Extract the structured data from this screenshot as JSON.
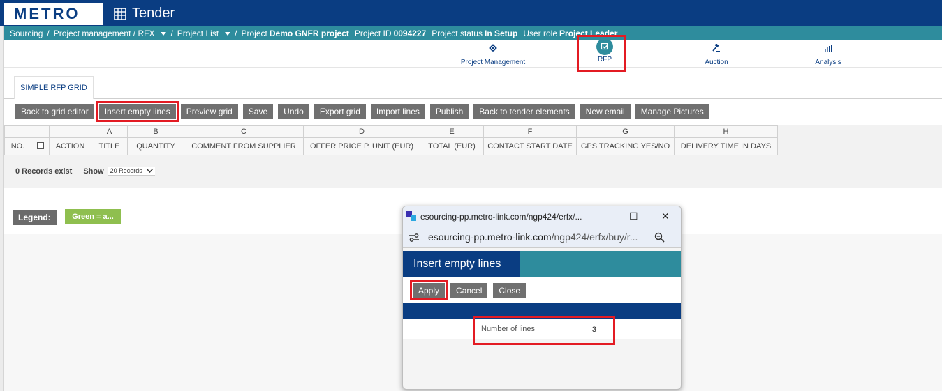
{
  "header": {
    "logo": "METRO",
    "app_title": "Tender"
  },
  "breadcrumb": {
    "sourcing": "Sourcing",
    "sep": "/",
    "project_mgmt": "Project management / RFX",
    "project_list": "Project List",
    "project_label": "Project",
    "project_name": "Demo GNFR project",
    "project_id_label": "Project ID",
    "project_id": "0094227",
    "status_label": "Project status",
    "status": "In Setup",
    "role_label": "User role",
    "role": "Project Leader"
  },
  "stepper": {
    "steps": [
      {
        "label": "Project Management",
        "icon": "gear-icon"
      },
      {
        "label": "RFP",
        "icon": "rfp-icon"
      },
      {
        "label": "Auction",
        "icon": "gavel-icon"
      },
      {
        "label": "Analysis",
        "icon": "bar-chart-icon"
      }
    ]
  },
  "tabs": {
    "simple_rfp_grid": "SIMPLE RFP GRID"
  },
  "toolbar": {
    "buttons": [
      "Back to grid editor",
      "Insert empty lines",
      "Preview grid",
      "Save",
      "Undo",
      "Export grid",
      "Import lines",
      "Publish",
      "Back to tender elements",
      "New email",
      "Manage Pictures"
    ]
  },
  "grid": {
    "letters": [
      "",
      "",
      "",
      "A",
      "B",
      "C",
      "D",
      "E",
      "F",
      "G",
      "H"
    ],
    "columns": [
      "NO.",
      "",
      "ACTION",
      "TITLE",
      "QUANTITY",
      "COMMENT FROM SUPPLIER",
      "OFFER PRICE P. UNIT (EUR)",
      "TOTAL (EUR)",
      "CONTACT START DATE",
      "GPS TRACKING YES/NO",
      "DELIVERY TIME IN DAYS"
    ],
    "records_text": "0 Records exist",
    "show_label": "Show",
    "page_size": "20 Records"
  },
  "legend": {
    "label": "Legend:",
    "green": "Green = a..."
  },
  "popup": {
    "window_title": "esourcing-pp.metro-link.com/ngp424/erfx/...",
    "url_host": "esourcing-pp.metro-link.com",
    "url_path": "/ngp424/erfx/buy/r...",
    "heading": "Insert empty lines",
    "apply": "Apply",
    "cancel": "Cancel",
    "close": "Close",
    "field_label": "Number of lines",
    "field_value": "3",
    "minimize": "—",
    "maximize": "☐",
    "close_x": "✕"
  },
  "colors": {
    "brand_blue": "#0a3d82",
    "teal": "#2e8c9d",
    "button_gray": "#707070",
    "highlight_red": "#e31b23",
    "legend_green": "#8fbf4f"
  }
}
